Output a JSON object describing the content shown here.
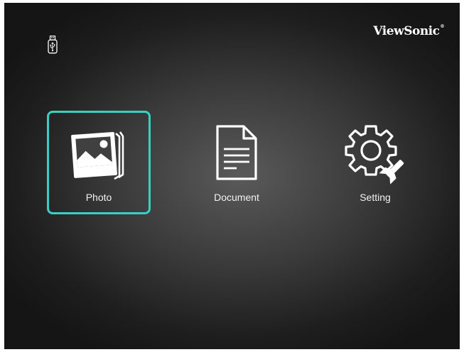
{
  "header": {
    "brand_name": "ViewSonic",
    "brand_mark": "®",
    "source_icon": "usb-drive-icon"
  },
  "menu": {
    "selected_index": 0,
    "accent_color": "#37d0c5",
    "items": [
      {
        "label": "Photo",
        "icon": "photo-icon"
      },
      {
        "label": "Document",
        "icon": "document-icon"
      },
      {
        "label": "Setting",
        "icon": "gear-wrench-icon"
      }
    ]
  }
}
